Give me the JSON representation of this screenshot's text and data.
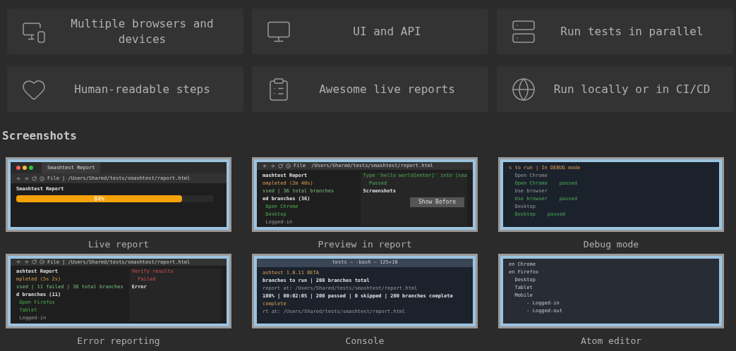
{
  "features": [
    {
      "label": "Multiple browsers and devices"
    },
    {
      "label": "UI and API"
    },
    {
      "label": "Run tests in parallel"
    },
    {
      "label": "Human-readable steps"
    },
    {
      "label": "Awesome live reports"
    },
    {
      "label": "Run locally or in CI/CD"
    }
  ],
  "section_title": "Screenshots",
  "screenshots": [
    {
      "caption": "Live report",
      "kind": "browser",
      "tab_title": "Smashtest Report",
      "address": "File | /Users/Shared/tests/smashtest/report.html",
      "columns": [
        [
          {
            "text": "Smashtest Report",
            "kind": "heading"
          }
        ]
      ],
      "progress": {
        "level": 0.84,
        "label": "84%"
      }
    },
    {
      "caption": "Preview in report",
      "kind": "browser",
      "address": "File  /Users/Shared/tests/smashtest/report.html",
      "columns": [
        [
          {
            "text": "mashtest Report",
            "kind": "heading"
          },
          {
            "text": "ompleted (2m 40s)",
            "kind": "warning"
          },
          {
            "text": "ssed | 36 total branches",
            "kind": "summary"
          },
          {
            "text": "ed branches (36)",
            "kind": "heading"
          },
          {
            "text": " Open Chrome",
            "kind": "passed"
          },
          {
            "text": " Desktop",
            "kind": "passed"
          },
          {
            "text": " Logged-in",
            "kind": "muted"
          }
        ],
        [
          {
            "text": "Type 'hello world[enter]' into [sea",
            "kind": "passed"
          },
          {
            "text": "  Passed",
            "kind": "passed"
          },
          {
            "text": "Screenshots",
            "kind": "heading"
          }
        ]
      ],
      "button": "Show Before"
    },
    {
      "caption": "Debug mode",
      "kind": "terminal",
      "columns": [
        [
          {
            "text": "s to run | In DEBUG mode",
            "kind": "warning"
          },
          {
            "text": "  Open Chrome",
            "kind": "muted"
          },
          {
            "text": "  Open Chrome    passed",
            "kind": "passed"
          },
          {
            "text": "  Use browser",
            "kind": "muted"
          },
          {
            "text": "  Use browser    passed",
            "kind": "passed"
          },
          {
            "text": "  Desktop",
            "kind": "muted"
          },
          {
            "text": "  Desktop    passed",
            "kind": "passed"
          }
        ]
      ]
    },
    {
      "caption": "Error reporting",
      "kind": "browser",
      "address": "File | /Users/Shared/tests/smashtest/report.html",
      "columns": [
        [
          {
            "text": "ashtest Report",
            "kind": "heading"
          },
          {
            "text": "mpleted (5s 2s)",
            "kind": "warning"
          },
          {
            "text": "ssed | 11 failed | 38 total branches",
            "kind": "summary"
          },
          {
            "text": "d branches (11)",
            "kind": "heading"
          },
          {
            "text": " Open Firefox",
            "kind": "passed"
          },
          {
            "text": " Tablet",
            "kind": "passed"
          },
          {
            "text": " Logged-in",
            "kind": "muted"
          }
        ],
        [
          {
            "text": "Verify results",
            "kind": "failed"
          },
          {
            "text": "  Failed",
            "kind": "failed"
          },
          {
            "text": "Error",
            "kind": "heading"
          }
        ]
      ]
    },
    {
      "caption": "Console",
      "kind": "terminal",
      "window_title": "tests — -bash — 125×10",
      "columns": [
        [
          {
            "text": "ashtest 1.0.11 BETA",
            "kind": "warning"
          },
          {
            "text": "branches to run | 200 branches total",
            "kind": "heading"
          },
          {
            "text": "report at: /Users/Shared/tests/smashtest/report.html",
            "kind": "muted"
          },
          {
            "text": "100% | 00:02:05 | 200 passed | 0 skipped | 200 branches complete",
            "kind": "heading"
          },
          {
            "text": "complete",
            "kind": "warning"
          },
          {
            "text": "rt at: /Users/Shared/tests/smashtest/report.html",
            "kind": "muted"
          }
        ]
      ]
    },
    {
      "caption": "Atom editor",
      "kind": "editor",
      "columns": [
        [
          {
            "text": "en Chrome",
            "kind": "plain"
          },
          {
            "text": "en Firefox",
            "kind": "plain"
          },
          {
            "text": "  Desktop",
            "kind": "plain"
          },
          {
            "text": "  Tablet",
            "kind": "plain"
          },
          {
            "text": "  Mobile",
            "kind": "plain"
          },
          {
            "text": "      - Logged-in",
            "kind": "plain"
          },
          {
            "text": "      - Logged-out",
            "kind": "plain"
          }
        ]
      ]
    }
  ]
}
